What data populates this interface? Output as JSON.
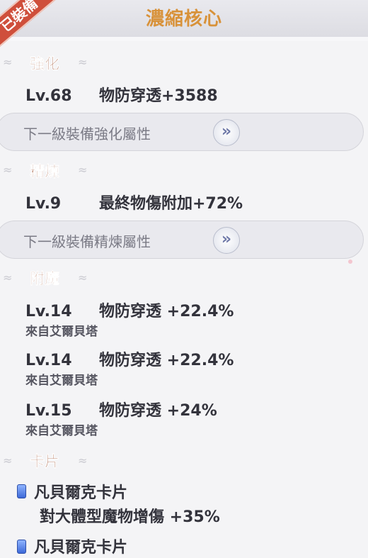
{
  "header": {
    "title": "濃縮核心",
    "ribbon_label": "已裝備"
  },
  "refine": {
    "title": "強化",
    "level": "Lv.68",
    "stat": "物防穿透+3588",
    "next_label": "下一級裝備強化屬性",
    "next_icon": "double-chevron-right-icon"
  },
  "smelt": {
    "title": "精煉",
    "level": "Lv.9",
    "stat": "最終物傷附加+72%",
    "next_label": "下一級裝備精煉屬性",
    "next_icon": "double-chevron-right-icon"
  },
  "enchant": {
    "title": "附魔",
    "items": [
      {
        "level": "Lv.14",
        "stat": "物防穿透 +22.4%",
        "source": "來自艾爾貝塔"
      },
      {
        "level": "Lv.14",
        "stat": "物防穿透 +22.4%",
        "source": "來自艾爾貝塔"
      },
      {
        "level": "Lv.15",
        "stat": "物防穿透 +24%",
        "source": "來自艾爾貝塔"
      }
    ]
  },
  "cards": {
    "title": "卡片",
    "items": [
      {
        "name": "凡貝爾克卡片",
        "effect": "對大體型魔物增傷 +35%"
      },
      {
        "name": "凡貝爾克卡片"
      }
    ]
  },
  "colors": {
    "title": "#d8923a",
    "section": "#9b4b2b",
    "ribbon": "#cf4f3b",
    "gem": "#3d69d8"
  }
}
